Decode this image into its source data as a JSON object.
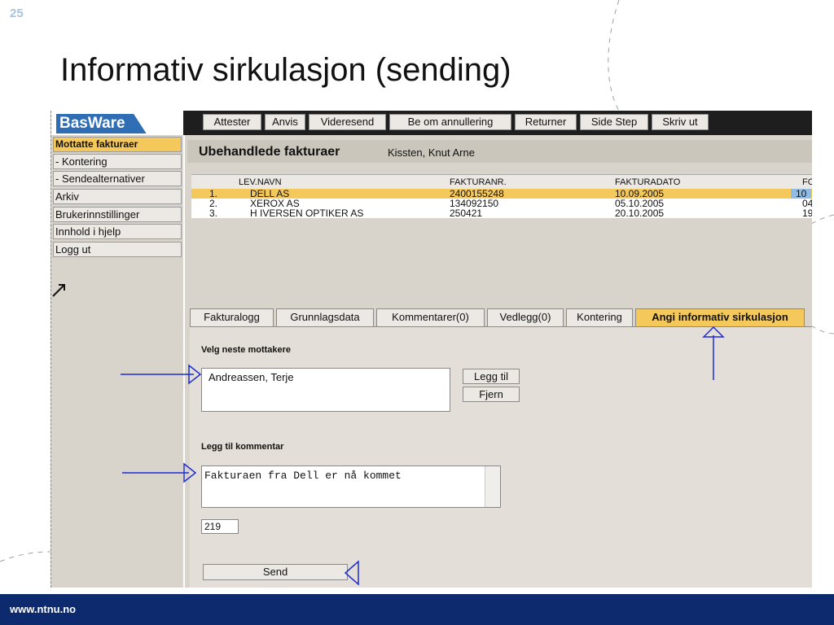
{
  "slide": {
    "number": "25",
    "title": "Informativ sirkulasjon (sending)",
    "footer_url": "www.ntnu.no"
  },
  "app": {
    "logo": "BasWare",
    "toolbar": [
      "Attester",
      "Anvis",
      "Videresend",
      "Be om annullering",
      "Returner",
      "Side Step",
      "Skriv ut"
    ],
    "sidebar": [
      "Mottatte fakturaer",
      "- Kontering",
      "- Sendealternativer",
      "Arkiv",
      "Brukerinnstillinger",
      "Innhold i hjelp",
      "Logg ut"
    ],
    "header": {
      "title": "Ubehandlede fakturaer",
      "user": "Kissten, Knut Arne"
    },
    "table": {
      "columns": [
        "LEV.NAVN",
        "FAKTURANR.",
        "FAKTURADATO",
        "FO"
      ],
      "rows": [
        {
          "num": "1.",
          "name": "DELL AS",
          "invoice": "2400155248",
          "date": "10.09.2005",
          "extra": "10"
        },
        {
          "num": "2.",
          "name": "XEROX AS",
          "invoice": "134092150",
          "date": "05.10.2005",
          "extra": "04"
        },
        {
          "num": "3.",
          "name": "H IVERSEN OPTIKER AS",
          "invoice": "250421",
          "date": "20.10.2005",
          "extra": "19"
        }
      ]
    },
    "tabs": [
      "Fakturalogg",
      "Grunnlagsdata",
      "Kommentarer(0)",
      "Vedlegg(0)",
      "Kontering",
      "Angi informativ sirkulasjon"
    ],
    "panel": {
      "recipients_label": "Velg neste mottakere",
      "recipient": "Andreassen, Terje",
      "add_label": "Legg til",
      "remove_label": "Fjern",
      "comment_label": "Legg til kommentar",
      "comment": "Fakturaen fra Dell er nå kommet",
      "char_count": "219",
      "send_label": "Send"
    }
  }
}
